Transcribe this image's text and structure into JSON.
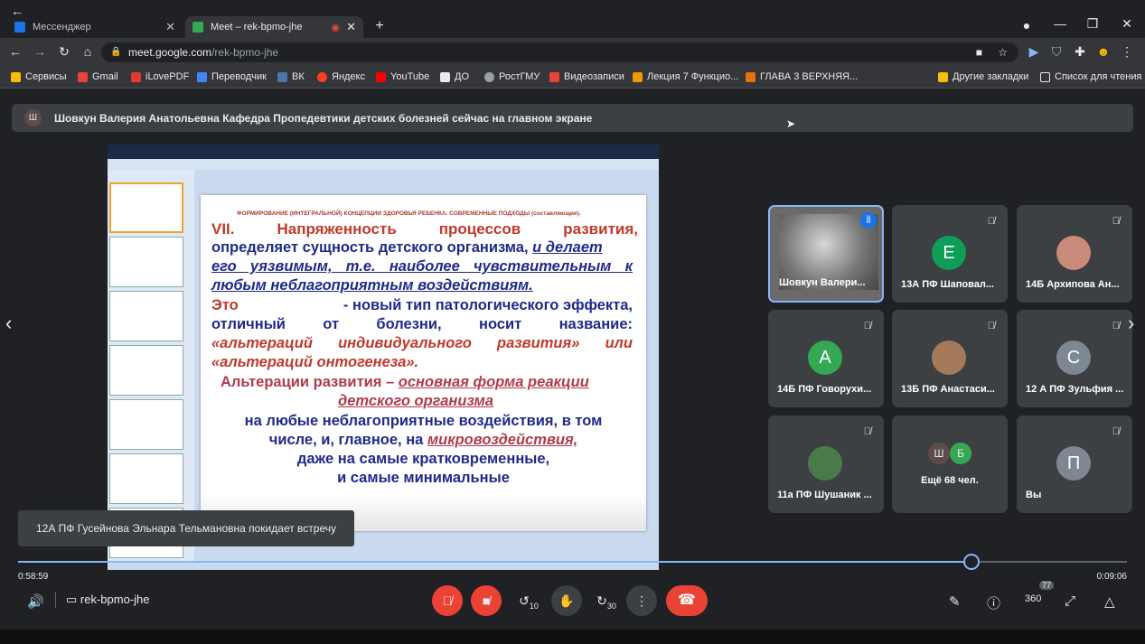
{
  "browser": {
    "tabs": [
      {
        "label": "Мессенджер",
        "active": false
      },
      {
        "label": "Meet – rek-bpmo-jhe",
        "active": true
      }
    ],
    "url_domain": "meet.google.com",
    "url_path": "/rek-bpmo-jhe",
    "bookmarks": [
      "Сервисы",
      "Gmail",
      "iLovePDF",
      "Переводчик",
      "ВК",
      "Яндекс",
      "YouTube",
      "ДО",
      "РостГМУ",
      "Видеозаписи",
      "Лекция 7 Функцио...",
      "ГЛАВА 3 ВЕРХНЯЯ...",
      "Другие закладки",
      "Список для чтения"
    ]
  },
  "banner": {
    "avatar": "Ш",
    "text": "Шовкун Валерия Анатольевна Кафедра Пропедевтики детских болезней сейчас на главном экране"
  },
  "slide": {
    "header": "ФОРМИРОВАНИЕ (ИНТЕГРАЛЬНОЙ) КОНЦЕПЦИИ ЗДОРОВЬЯ РЕБЕНКА. СОВРЕМЕННЫЕ ПОДХОДЫ (составляющие).",
    "l1a": "VII. Напряженность процессов развития,",
    "l2a": "определяет сущность детского организма,",
    "l2b": "и делает",
    "l3": "его уязвимым, т.е. наиболее чувствительным к",
    "l4": "любым неблагоприятным воздействиям.",
    "l5a": "Это",
    "l5b": "- новый тип патологического эффекта,",
    "l6": "отличный от болезни, носит название:",
    "l7": "«альтераций индивидуального развития» или",
    "l8": "«альтераций онтогенеза».",
    "l9a": "Альтерации развития –",
    "l9b": "основная форма реакции",
    "l10": "детского организма",
    "l11": "на любые неблагоприятные воздействия, в том",
    "l12a": "числе, и, главное, на",
    "l12b": "микровоздействия,",
    "l13": "даже на самые кратковременные,",
    "l14": "и самые минимальные"
  },
  "participants": [
    {
      "name": "Шовкун Валери...",
      "avatar": "",
      "color": "#8a8a8a",
      "muted": false
    },
    {
      "name": "13А ПФ Шаповал...",
      "avatar": "E",
      "color": "#0f9d58",
      "muted": true
    },
    {
      "name": "14Б Архипова Ан...",
      "avatar": "",
      "color": "#c98a7a",
      "muted": true
    },
    {
      "name": "14Б ПФ Говорухи...",
      "avatar": "A",
      "color": "#34a853",
      "muted": true
    },
    {
      "name": "13Б ПФ Анастаси...",
      "avatar": "",
      "color": "#a57a5a",
      "muted": true
    },
    {
      "name": "12 А ПФ Зульфия ...",
      "avatar": "C",
      "color": "#7d8893",
      "muted": true
    },
    {
      "name": "11а ПФ Шушаник ...",
      "avatar": "",
      "color": "#4a7a4a",
      "muted": true
    },
    {
      "name": "Ещё 68 чел.",
      "avatar": "",
      "color": "#3c4043",
      "muted": false
    },
    {
      "name": "Вы",
      "avatar": "П",
      "color": "#7d8893",
      "muted": true
    }
  ],
  "more_avatars": [
    "Ш",
    "Б"
  ],
  "toast": "12А ПФ Гусейнова Эльнара Тельмановна покидает встречу",
  "player": {
    "current": "0:58:59",
    "total": "0:09:06",
    "progress": 0.86
  },
  "meeting_code": "rek-bpmo-jhe",
  "controls": {
    "rewind": "10",
    "forward": "30",
    "people_count": "77",
    "speed": "360"
  },
  "colors": {
    "accent": "#8ab4f8",
    "danger": "#ea4335",
    "slide_red": "#c0392b",
    "slide_blue": "#1f2a8a"
  }
}
